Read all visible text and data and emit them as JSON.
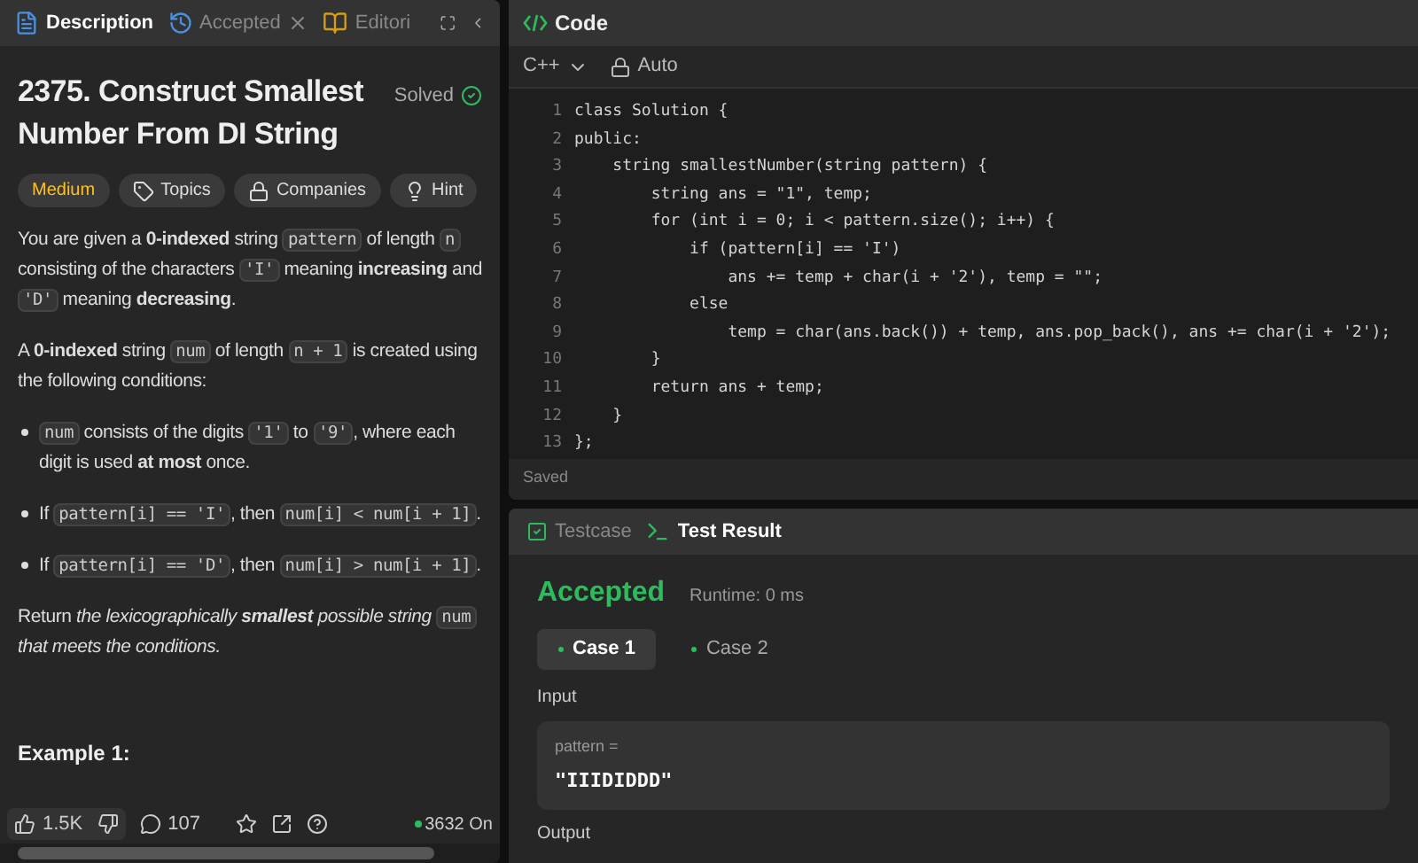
{
  "left_tabs": [
    {
      "label": "Description",
      "selected": true,
      "kind": "description"
    },
    {
      "label": "Accepted",
      "selected": false,
      "kind": "accepted"
    },
    {
      "label": "Editori",
      "selected": false,
      "kind": "editorial"
    }
  ],
  "problem": {
    "title": "2375. Construct Smallest Number From DI String",
    "status": "Solved",
    "tags": [
      {
        "label": "Medium",
        "kind": "difficulty"
      },
      {
        "label": "Topics",
        "kind": "topics"
      },
      {
        "label": "Companies",
        "kind": "companies"
      },
      {
        "label": "Hint",
        "kind": "hint"
      }
    ],
    "paragraphs": [
      {
        "kind": "para",
        "segments": [
          {
            "kind": "text",
            "text": "You are given a **0-indexed** string "
          },
          {
            "kind": "code",
            "text": "pattern"
          },
          {
            "kind": "text",
            "text": " of length "
          },
          {
            "kind": "code",
            "text": "n"
          },
          {
            "kind": "text",
            "text": " consisting of the characters "
          },
          {
            "kind": "code",
            "text": "'I'"
          },
          {
            "kind": "text",
            "text": " meaning **increasing** and "
          },
          {
            "kind": "code",
            "text": "'D'"
          },
          {
            "kind": "text",
            "text": " meaning **decreasing**."
          }
        ]
      },
      {
        "kind": "para",
        "segments": [
          {
            "kind": "text",
            "text": "A **0-indexed** string "
          },
          {
            "kind": "code",
            "text": "num"
          },
          {
            "kind": "text",
            "text": " of length "
          },
          {
            "kind": "code",
            "text": "n + 1"
          },
          {
            "kind": "text",
            "text": " is created using the following conditions:"
          }
        ]
      },
      {
        "kind": "bullet",
        "segments": [
          {
            "kind": "code",
            "text": "num"
          },
          {
            "kind": "text",
            "text": " consists of the digits "
          },
          {
            "kind": "code",
            "text": "'1'"
          },
          {
            "kind": "text",
            "text": " to "
          },
          {
            "kind": "code",
            "text": "'9'"
          },
          {
            "kind": "text",
            "text": ", where each digit is used **at most** once."
          }
        ]
      },
      {
        "kind": "bullet",
        "segments": [
          {
            "kind": "text",
            "text": "If "
          },
          {
            "kind": "code",
            "text": "pattern[i] == 'I'"
          },
          {
            "kind": "text",
            "text": ", then "
          },
          {
            "kind": "code",
            "text": "num[i] < num[i + 1]"
          },
          {
            "kind": "text",
            "text": "."
          }
        ]
      },
      {
        "kind": "bullet",
        "segments": [
          {
            "kind": "text",
            "text": "If "
          },
          {
            "kind": "code",
            "text": "pattern[i] == 'D'"
          },
          {
            "kind": "text",
            "text": ", then "
          },
          {
            "kind": "code",
            "text": "num[i] > num[i + 1]"
          },
          {
            "kind": "text",
            "text": "."
          }
        ]
      },
      {
        "kind": "para",
        "segments": [
          {
            "kind": "text",
            "text": "Return "
          },
          {
            "kind": "italic",
            "text": "the lexicographically **smallest** possible string "
          },
          {
            "kind": "code",
            "text": "num"
          },
          {
            "kind": "italic",
            "text": " that meets the conditions."
          }
        ]
      }
    ],
    "example_heading": "Example 1:"
  },
  "footer": {
    "likes": "1.5K",
    "comments": "107",
    "online": "3632 On"
  },
  "code": {
    "title": "Code",
    "language": "C++",
    "mode": "Auto",
    "lines": [
      {
        "number": "1",
        "text": "class Solution {"
      },
      {
        "number": "2",
        "text": "public:"
      },
      {
        "number": "3",
        "text": "    string smallestNumber(string pattern) {"
      },
      {
        "number": "4",
        "text": "        string ans = \"1\", temp;"
      },
      {
        "number": "5",
        "text": "        for (int i = 0; i < pattern.size(); i++) {"
      },
      {
        "number": "6",
        "text": "            if (pattern[i] == 'I')"
      },
      {
        "number": "7",
        "text": "                ans += temp + char(i + '2'), temp = \"\";"
      },
      {
        "number": "8",
        "text": "            else"
      },
      {
        "number": "9",
        "text": "                temp = char(ans.back()) + temp, ans.pop_back(), ans += char(i + '2');"
      },
      {
        "number": "10",
        "text": "        }"
      },
      {
        "number": "11",
        "text": "        return ans + temp;"
      },
      {
        "number": "12",
        "text": "    }"
      },
      {
        "number": "13",
        "text": "};"
      }
    ],
    "status": "Saved"
  },
  "bottom_tabs": [
    {
      "label": "Testcase",
      "selected": false,
      "kind": "testcase"
    },
    {
      "label": "Test Result",
      "selected": true,
      "kind": "result"
    }
  ],
  "result": {
    "verdict": "Accepted",
    "runtime": "Runtime: 0 ms",
    "cases": [
      {
        "label": "Case 1",
        "selected": true
      },
      {
        "label": "Case 2",
        "selected": false
      }
    ],
    "input_label": "Input",
    "param_name": "pattern =",
    "param_value": "\"IIIDIDDD\"",
    "output_label": "Output"
  }
}
